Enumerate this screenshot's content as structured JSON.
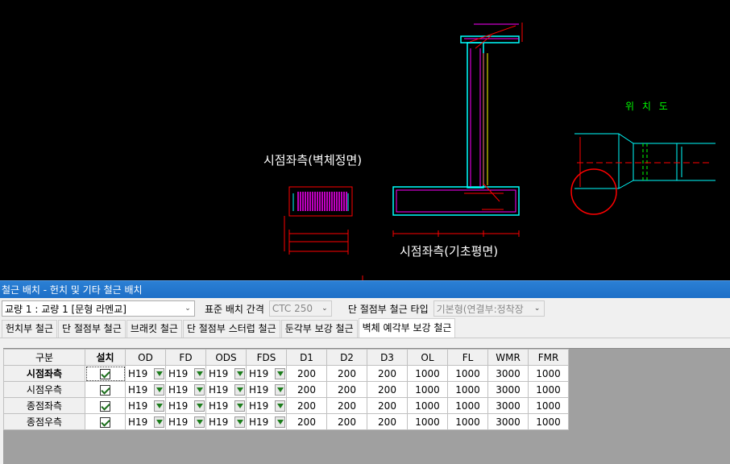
{
  "cad": {
    "label_wall_front": "시점좌측(벽체정면)",
    "label_foundation_plan": "시점좌측(기초평면)",
    "label_location": "위 치 도"
  },
  "panel": {
    "title": "철근 배치 - 헌치 및 기타 철근 배치",
    "bridge_select": "교량 1 : 교량 1 [문형 라멘교]",
    "spacing_label": "표준 배치 간격",
    "spacing_value": "CTC 250",
    "end_type_label": "단 절점부 철근 타입",
    "end_type_value": "기본형(연결부:정착장"
  },
  "tabs": [
    {
      "label": "헌치부 철근"
    },
    {
      "label": "단 절점부 철근"
    },
    {
      "label": "브래킷 철근"
    },
    {
      "label": "단 절점부 스터럽 철근"
    },
    {
      "label": "둔각부 보강 철근"
    },
    {
      "label": "벽체 예각부 보강 철근"
    }
  ],
  "grid": {
    "headers": [
      "구분",
      "설치",
      "OD",
      "FD",
      "ODS",
      "FDS",
      "D1",
      "D2",
      "D3",
      "OL",
      "FL",
      "WMR",
      "FMR"
    ],
    "rows": [
      {
        "name": "시점좌측",
        "od": "H19",
        "fd": "H19",
        "ods": "H19",
        "fds": "H19",
        "d1": "200",
        "d2": "200",
        "d3": "200",
        "ol": "1000",
        "fl": "1000",
        "wmr": "3000",
        "fmr": "1000"
      },
      {
        "name": "시점우측",
        "od": "H19",
        "fd": "H19",
        "ods": "H19",
        "fds": "H19",
        "d1": "200",
        "d2": "200",
        "d3": "200",
        "ol": "1000",
        "fl": "1000",
        "wmr": "3000",
        "fmr": "1000"
      },
      {
        "name": "종점좌측",
        "od": "H19",
        "fd": "H19",
        "ods": "H19",
        "fds": "H19",
        "d1": "200",
        "d2": "200",
        "d3": "200",
        "ol": "1000",
        "fl": "1000",
        "wmr": "3000",
        "fmr": "1000"
      },
      {
        "name": "종점우측",
        "od": "H19",
        "fd": "H19",
        "ods": "H19",
        "fds": "H19",
        "d1": "200",
        "d2": "200",
        "d3": "200",
        "ol": "1000",
        "fl": "1000",
        "wmr": "3000",
        "fmr": "1000"
      }
    ]
  },
  "colors": {
    "titlebar": "#1d6fc7",
    "cad_background": "#000000",
    "checkbox_check": "#1a6e1a"
  }
}
